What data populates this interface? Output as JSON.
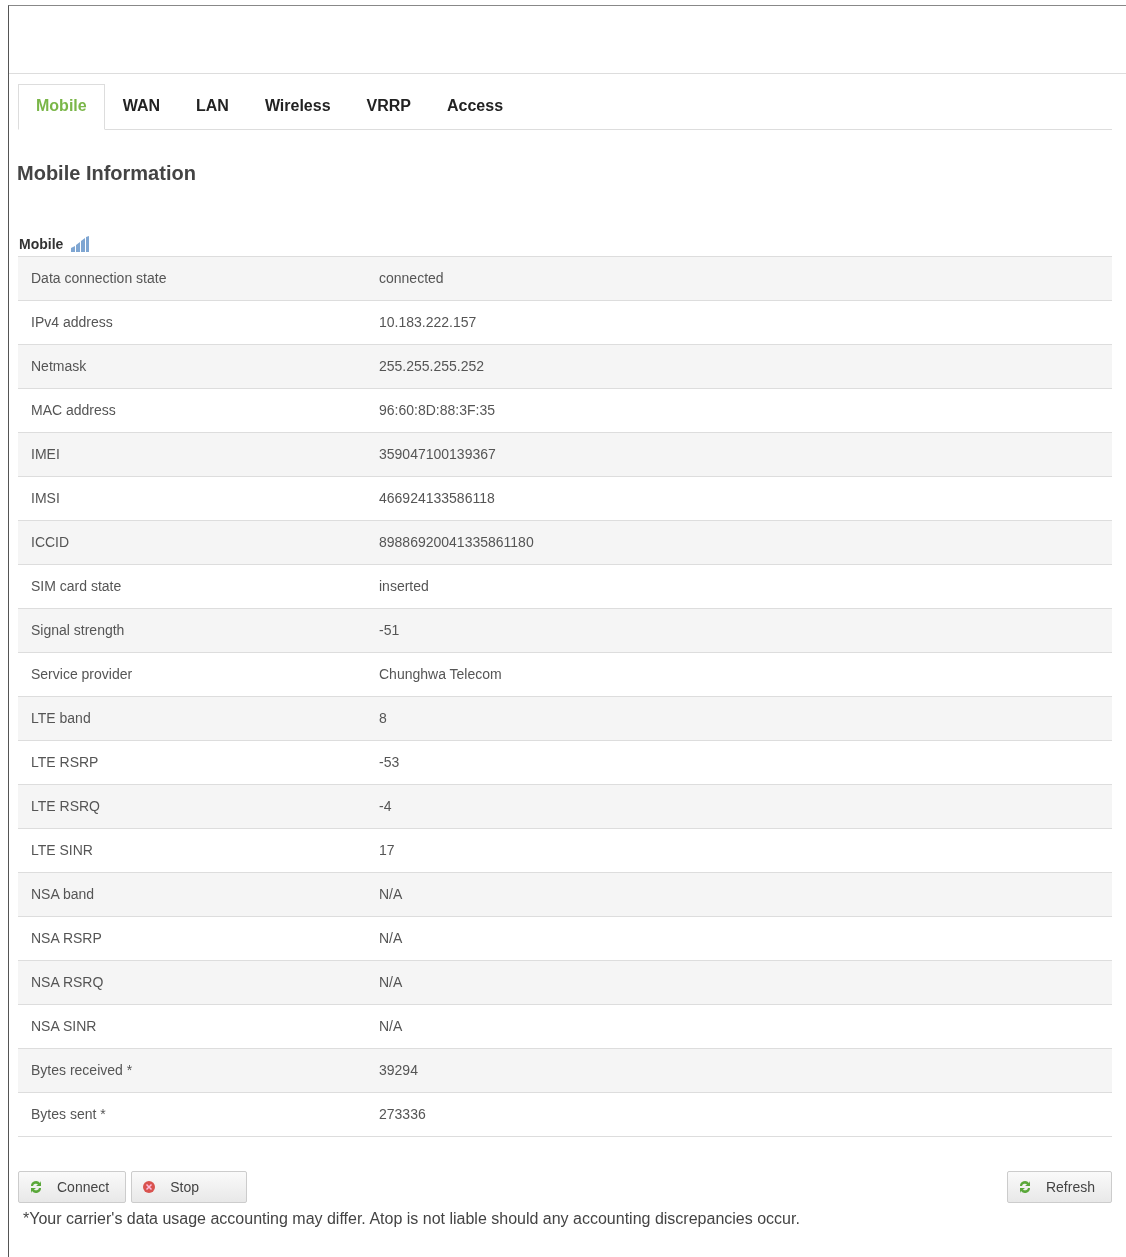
{
  "tabs": [
    {
      "label": "Mobile",
      "selected": true
    },
    {
      "label": "WAN",
      "selected": false
    },
    {
      "label": "LAN",
      "selected": false
    },
    {
      "label": "Wireless",
      "selected": false
    },
    {
      "label": "VRRP",
      "selected": false
    },
    {
      "label": "Access",
      "selected": false
    }
  ],
  "heading": "Mobile Information",
  "section": {
    "title": "Mobile"
  },
  "rows": [
    {
      "label": "Data connection state",
      "value": "connected"
    },
    {
      "label": "IPv4 address",
      "value": "10.183.222.157"
    },
    {
      "label": "Netmask",
      "value": "255.255.255.252"
    },
    {
      "label": "MAC address",
      "value": "96:60:8D:88:3F:35"
    },
    {
      "label": "IMEI",
      "value": "359047100139367"
    },
    {
      "label": "IMSI",
      "value": "466924133586118"
    },
    {
      "label": "ICCID",
      "value": "89886920041335861180"
    },
    {
      "label": "SIM card state",
      "value": "inserted"
    },
    {
      "label": "Signal strength",
      "value": "-51"
    },
    {
      "label": "Service provider",
      "value": "Chunghwa Telecom"
    },
    {
      "label": "LTE band",
      "value": "8"
    },
    {
      "label": "LTE RSRP",
      "value": "-53"
    },
    {
      "label": "LTE RSRQ",
      "value": "-4"
    },
    {
      "label": "LTE SINR",
      "value": "17"
    },
    {
      "label": "NSA band",
      "value": "N/A"
    },
    {
      "label": "NSA RSRP",
      "value": "N/A"
    },
    {
      "label": "NSA RSRQ",
      "value": "N/A"
    },
    {
      "label": "NSA SINR",
      "value": "N/A"
    },
    {
      "label": "Bytes received *",
      "value": "39294"
    },
    {
      "label": "Bytes sent *",
      "value": "273336"
    }
  ],
  "buttons": [
    {
      "label": "Connect",
      "kind": "refresh"
    },
    {
      "label": "Stop",
      "kind": "stop"
    },
    {
      "label": "Refresh",
      "kind": "refresh"
    }
  ],
  "footnote": "*Your carrier's data usage accounting may differ. Atop is not liable should any accounting discrepancies occur."
}
